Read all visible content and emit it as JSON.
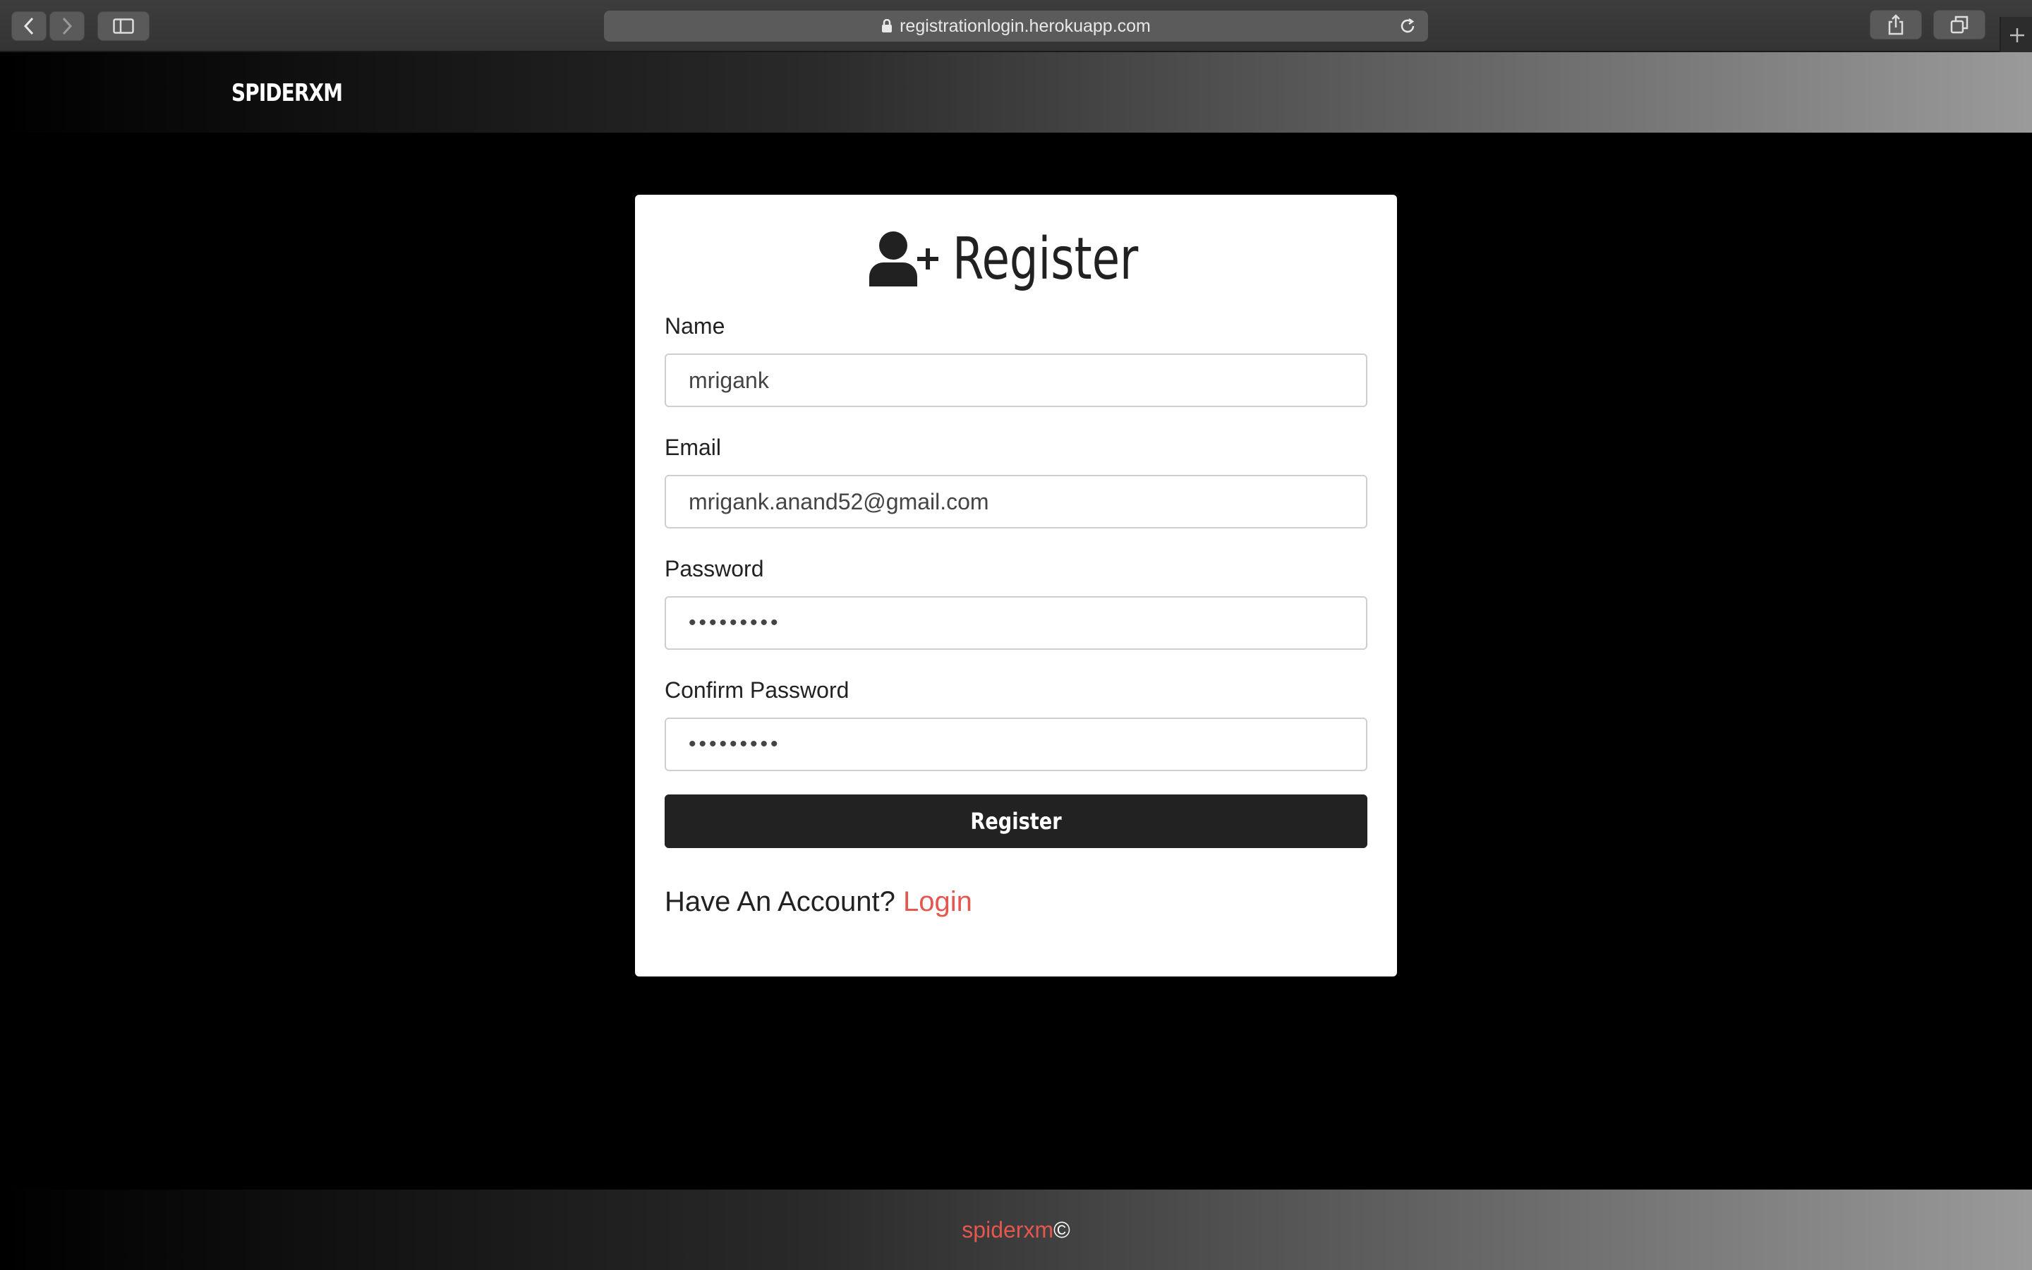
{
  "browser": {
    "url": "registrationlogin.herokuapp.com",
    "icons": {
      "back": "chevron-left-icon",
      "forward": "chevron-right-icon",
      "sidebar": "sidebar-icon",
      "lock": "lock-icon",
      "reload": "reload-icon",
      "share": "share-icon",
      "tabs": "tabs-icon",
      "new_tab": "plus-icon"
    }
  },
  "navbar": {
    "brand": "SPIDERXM"
  },
  "form": {
    "title": "Register",
    "title_icon": "user-plus-icon",
    "fields": [
      {
        "label": "Name",
        "value": "mrigank"
      },
      {
        "label": "Email",
        "value": "mrigank.anand52@gmail.com"
      },
      {
        "label": "Password",
        "value": "•••••••••"
      },
      {
        "label": "Confirm Password",
        "value": "•••••••••"
      }
    ],
    "submit_label": "Register",
    "account_prompt": "Have An Account?",
    "login_link": "Login"
  },
  "footer": {
    "brand": "spiderxm",
    "copyright": "©"
  },
  "colors": {
    "accent": "#e4574f",
    "button": "#222222",
    "background": "#000000"
  }
}
